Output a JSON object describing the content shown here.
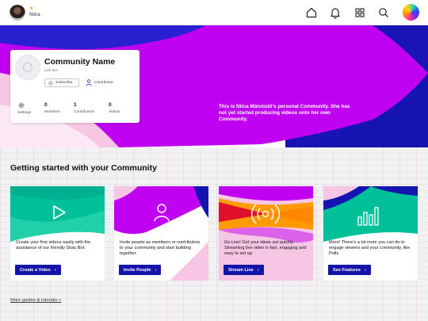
{
  "topbar": {
    "user_name": "Niina",
    "user_badge": "★",
    "icons": [
      "home-icon",
      "bell-icon",
      "grid-icon",
      "search-icon",
      "brand-logo"
    ]
  },
  "hero": {
    "text": "This is Niina Männistö's personal Community. She has not yet started producing videos onto her own Community."
  },
  "community": {
    "name": "Community Name",
    "link_text": "Link text",
    "subscribe_label": "Subscribe",
    "contributor_label": "Contributor",
    "settings_label": "Settings",
    "stats": [
      {
        "value": "0",
        "label": "Members"
      },
      {
        "value": "1",
        "label": "Contributors"
      },
      {
        "value": "0",
        "label": "Videos"
      }
    ]
  },
  "getting_started": {
    "title": "Getting started with your Community",
    "tiles": [
      {
        "text": "Create your first videos easily with the assistance of our friendly Stoiu Bot.",
        "button": "Create a Video",
        "icon": "play-icon"
      },
      {
        "text": "Invite people as members or contributors to your community and start building together.",
        "button": "Invite People",
        "icon": "person-icon"
      },
      {
        "text": "Go Live! Get your ideas out quickly. Streaming live video is fast, engaging and easy to set up.",
        "button": "Stream Live",
        "icon": "live-broadcast-icon"
      },
      {
        "text": "More! There's a lot more you can do to engage viewers and your community, like Polls.",
        "button": "See Features",
        "icon": "bar-chart-icon"
      }
    ],
    "more_link": "More guides & tutorials »"
  },
  "colors": {
    "magenta": "#c000f0",
    "navy": "#1414b0",
    "teal": "#00c09a",
    "pink": "#f6c6e4",
    "orange": "#ff9a00",
    "red": "#e0102a",
    "button": "#1414a8"
  }
}
